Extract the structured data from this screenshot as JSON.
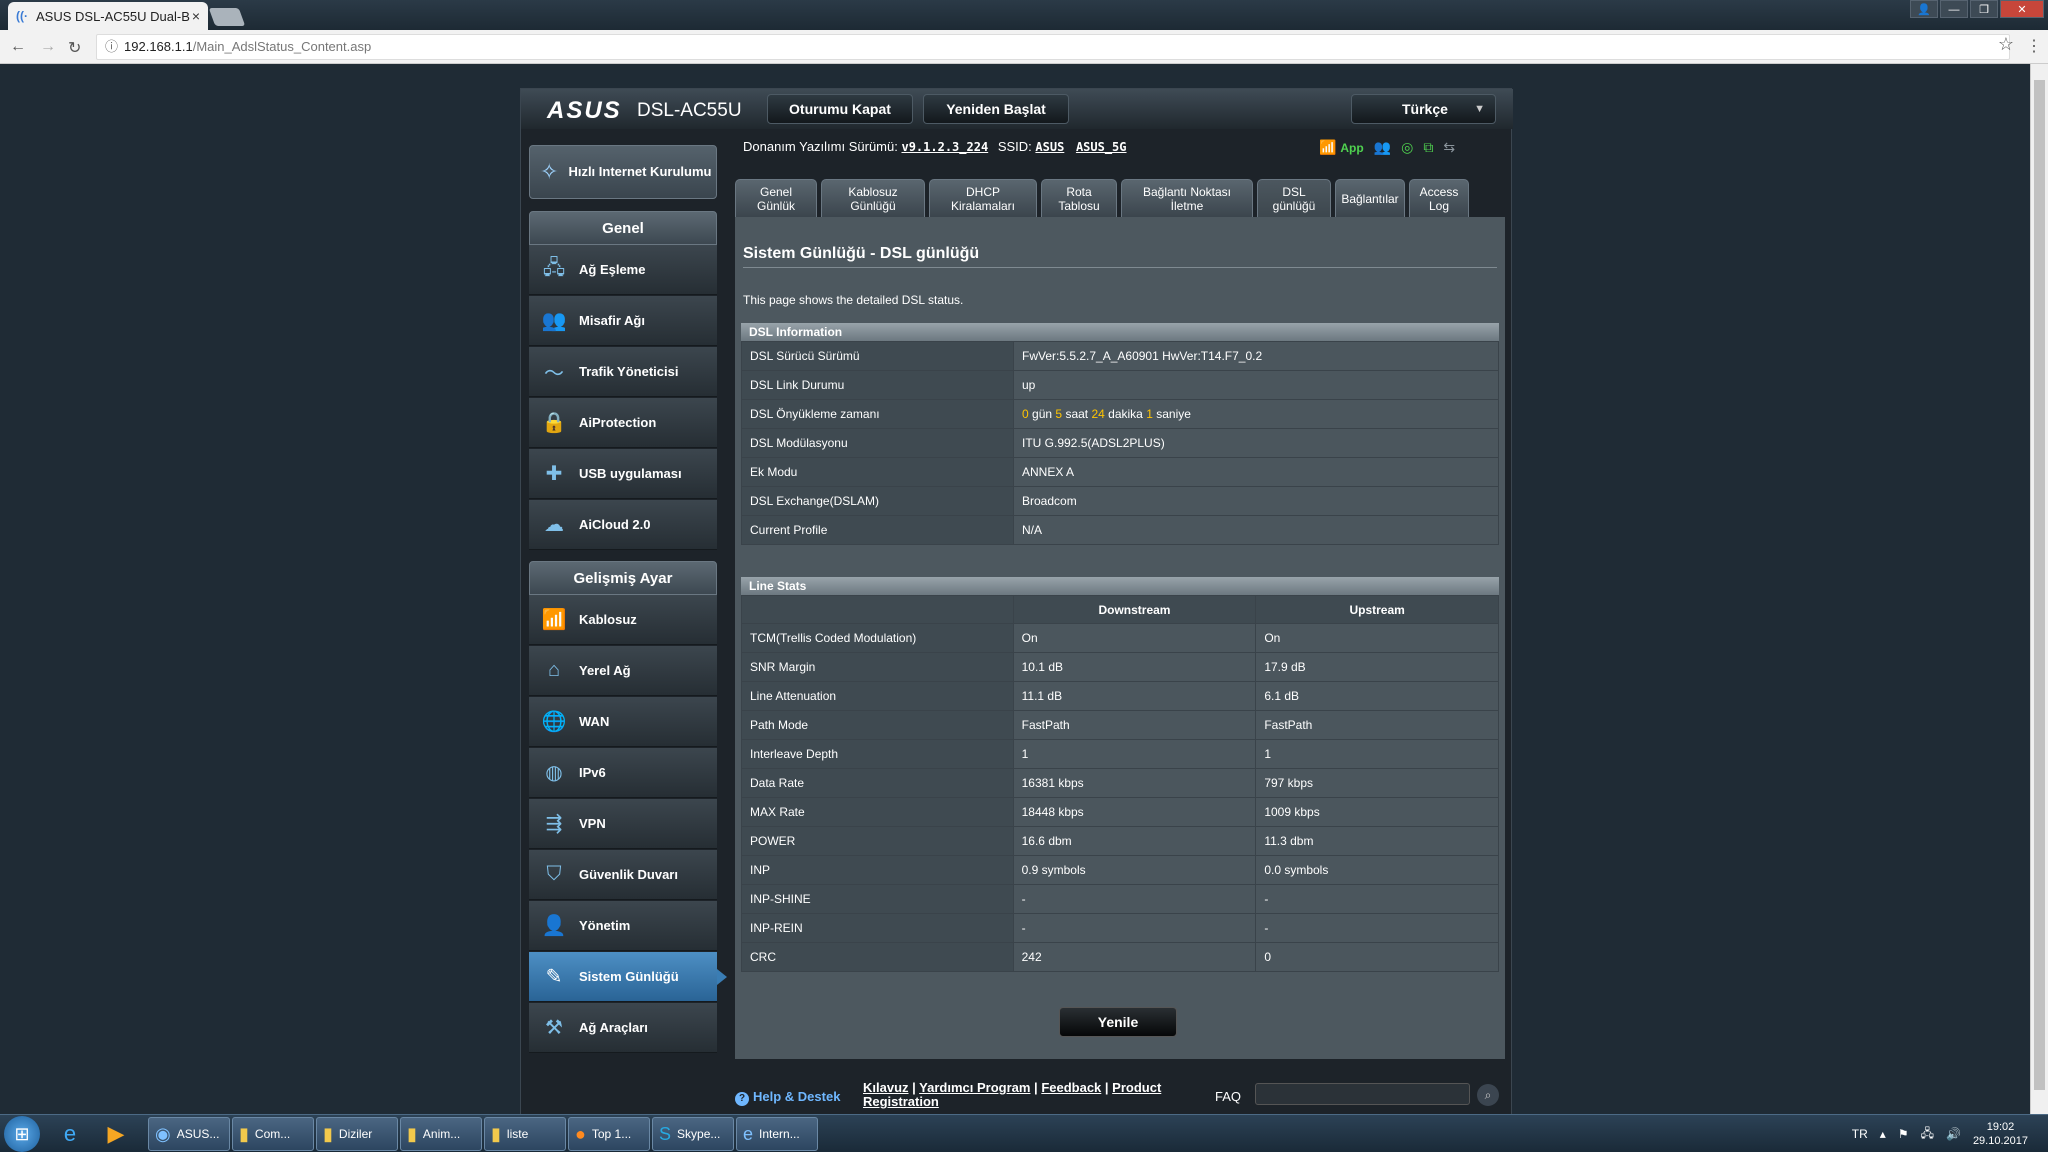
{
  "browser": {
    "tab_title": "ASUS DSL-AC55U Dual-B",
    "tab_close": "×",
    "url_host": "192.168.1.1",
    "url_path": "/Main_AdslStatus_Content.asp"
  },
  "router": {
    "logo": "ASUS",
    "model": "DSL-AC55U",
    "logout_label": "Oturumu Kapat",
    "reboot_label": "Yeniden Başlat",
    "language": "Türkçe",
    "firmware_label": "Donanım Yazılımı Sürümü:",
    "firmware_version": "v9.1.2.3_224",
    "ssid_label": "SSID:",
    "ssid_1": "ASUS",
    "ssid_2": "ASUS_5G",
    "app_label": "App"
  },
  "sidebar": {
    "qis_label": "Hızlı Internet Kurulumu",
    "general_header": "Genel",
    "general_items": [
      {
        "label": "Ağ Eşleme",
        "icon": "network-map-icon"
      },
      {
        "label": "Misafir Ağı",
        "icon": "guest-network-icon"
      },
      {
        "label": "Trafik Yöneticisi",
        "icon": "traffic-manager-icon"
      },
      {
        "label": "AiProtection",
        "icon": "lock-icon"
      },
      {
        "label": "USB uygulaması",
        "icon": "puzzle-icon"
      },
      {
        "label": "AiCloud 2.0",
        "icon": "cloud-icon"
      }
    ],
    "advanced_header": "Gelişmiş Ayar",
    "advanced_items": [
      {
        "label": "Kablosuz",
        "icon": "wifi-icon"
      },
      {
        "label": "Yerel Ağ",
        "icon": "home-icon"
      },
      {
        "label": "WAN",
        "icon": "globe-icon"
      },
      {
        "label": "IPv6",
        "icon": "ipv6-icon"
      },
      {
        "label": "VPN",
        "icon": "vpn-icon"
      },
      {
        "label": "Güvenlik Duvarı",
        "icon": "shield-icon"
      },
      {
        "label": "Yönetim",
        "icon": "user-icon"
      },
      {
        "label": "Sistem Günlüğü",
        "icon": "log-icon"
      },
      {
        "label": "Ağ Araçları",
        "icon": "tools-icon"
      }
    ]
  },
  "tabs": [
    {
      "label": "Genel\nGünlük"
    },
    {
      "label": "Kablosuz\nGünlüğü"
    },
    {
      "label": "DHCP\nKiralamaları"
    },
    {
      "label": "Rota\nTablosu"
    },
    {
      "label": "Bağlantı Noktası\nİletme"
    },
    {
      "label": "DSL\ngünlüğü"
    },
    {
      "label": "Bağlantılar"
    },
    {
      "label": "Access\nLog"
    }
  ],
  "page": {
    "title": "Sistem Günlüğü - DSL günlüğü",
    "description": "This page shows the detailed DSL status.",
    "dsl_info_header": "DSL Information",
    "dsl_info": [
      {
        "key": "DSL Sürücü Sürümü",
        "value": "FwVer:5.5.2.7_A_A60901 HwVer:T14.F7_0.2"
      },
      {
        "key": "DSL Link Durumu",
        "value": "up"
      },
      {
        "key": "DSL Önyükleme zamanı",
        "value": ""
      },
      {
        "key": "DSL Modülasyonu",
        "value": "ITU G.992.5(ADSL2PLUS)"
      },
      {
        "key": "Ek Modu",
        "value": "ANNEX A"
      },
      {
        "key": "DSL Exchange(DSLAM)",
        "value": "Broadcom"
      },
      {
        "key": "Current Profile",
        "value": "N/A"
      }
    ],
    "uptime": {
      "days": "0",
      "days_unit": "gün",
      "hours": "5",
      "hours_unit": "saat",
      "minutes": "24",
      "minutes_unit": "dakika",
      "seconds": "1",
      "seconds_unit": "saniye"
    },
    "line_stats_header": "Line Stats",
    "col_downstream": "Downstream",
    "col_upstream": "Upstream",
    "line_stats": [
      {
        "key": "TCM(Trellis Coded Modulation)",
        "down": "On",
        "up": "On"
      },
      {
        "key": "SNR Margin",
        "down": "10.1 dB",
        "up": "17.9 dB"
      },
      {
        "key": "Line Attenuation",
        "down": "11.1 dB",
        "up": "6.1 dB"
      },
      {
        "key": "Path Mode",
        "down": "FastPath",
        "up": "FastPath"
      },
      {
        "key": "Interleave Depth",
        "down": "1",
        "up": "1"
      },
      {
        "key": "Data Rate",
        "down": "16381 kbps",
        "up": "797 kbps"
      },
      {
        "key": "MAX Rate",
        "down": "18448 kbps",
        "up": "1009 kbps"
      },
      {
        "key": "POWER",
        "down": "16.6 dbm",
        "up": "11.3 dbm"
      },
      {
        "key": "INP",
        "down": "0.9 symbols",
        "up": "0.0 symbols"
      },
      {
        "key": "INP-SHINE",
        "down": "-",
        "up": "-"
      },
      {
        "key": "INP-REIN",
        "down": "-",
        "up": "-"
      },
      {
        "key": "CRC",
        "down": "242",
        "up": "0"
      }
    ],
    "refresh_label": "Yenile"
  },
  "footer": {
    "help": "Help & Destek",
    "link_manual": "Kılavuz",
    "link_utility": "Yardımcı Program",
    "link_feedback": "Feedback",
    "link_product": "Product Registration",
    "faq": "FAQ"
  },
  "taskbar": {
    "buttons": [
      {
        "label": "ASUS...",
        "icon": "chrome-icon"
      },
      {
        "label": "Com...",
        "icon": "folder-icon"
      },
      {
        "label": "Diziler",
        "icon": "folder-icon"
      },
      {
        "label": "Anim...",
        "icon": "folder-icon"
      },
      {
        "label": "liste",
        "icon": "folder-icon"
      },
      {
        "label": "Top 1...",
        "icon": "firefox-icon"
      },
      {
        "label": "Skype...",
        "icon": "skype-icon"
      },
      {
        "label": "Intern...",
        "icon": "ie-icon"
      }
    ],
    "lang": "TR",
    "time": "19:02",
    "date": "29.10.2017"
  },
  "colors": {
    "accent": "#4d8fc4",
    "highlight": "#ffc400",
    "content_bg": "#4d585f"
  }
}
